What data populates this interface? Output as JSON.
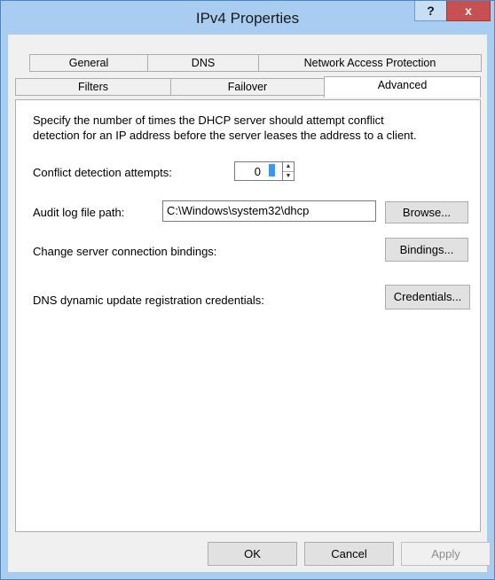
{
  "window": {
    "title": "IPv4 Properties",
    "help_glyph": "?",
    "close_glyph": "x"
  },
  "tabs": {
    "row1": [
      "General",
      "DNS",
      "Network Access Protection"
    ],
    "row2": [
      "Filters",
      "Failover",
      "Advanced"
    ],
    "active": "Advanced"
  },
  "advanced": {
    "description_line1": "Specify the number of times the DHCP server should attempt conflict",
    "description_line2": "detection for an IP address before the server leases the address to a client.",
    "conflict_label": "Conflict detection attempts:",
    "conflict_value": "0",
    "audit_label": "Audit log file path:",
    "audit_value": "C:\\Windows\\system32\\dhcp",
    "browse_label": "Browse...",
    "bindings_text": "Change server connection bindings:",
    "bindings_button": "Bindings...",
    "credentials_text": "DNS dynamic update registration credentials:",
    "credentials_button": "Credentials..."
  },
  "buttons": {
    "ok": "OK",
    "cancel": "Cancel",
    "apply": "Apply"
  }
}
